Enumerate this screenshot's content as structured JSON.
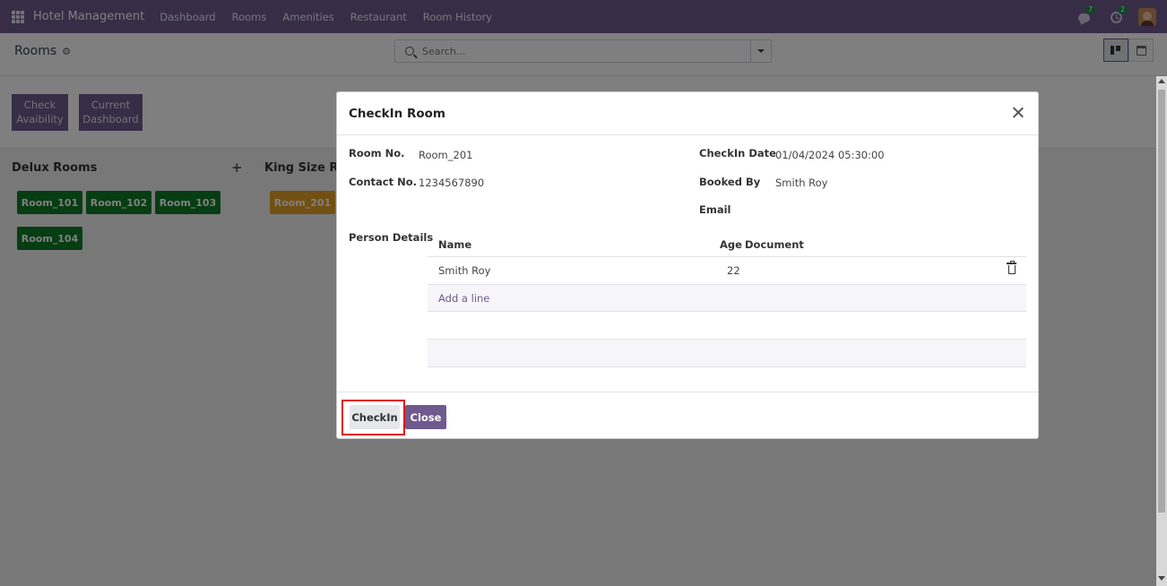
{
  "navbar": {
    "brand": "Hotel Management",
    "menu": [
      "Dashboard",
      "Rooms",
      "Amenities",
      "Restaurant",
      "Room History"
    ],
    "messages_count": "7",
    "activities_count": "2",
    "color": "#6f5a8e"
  },
  "control_panel": {
    "breadcrumb": "Rooms",
    "search_placeholder": "Search..."
  },
  "actions": {
    "check_availability": "Check Avaibility",
    "current_dashboard": "Current Dashboard"
  },
  "kanban": {
    "columns": [
      {
        "title": "Delux Rooms",
        "rooms": [
          "Room_101",
          "Room_102",
          "Room_103",
          "Room_104"
        ]
      },
      {
        "title": "King Size Roo",
        "rooms": [
          "Room_201"
        ]
      }
    ]
  },
  "modal": {
    "title": "CheckIn Room",
    "fields": {
      "room_no_label": "Room No.",
      "room_no_value": "Room_201",
      "contact_label": "Contact No.",
      "contact_value": "1234567890",
      "checkin_date_label": "CheckIn Date",
      "checkin_date_value": "01/04/2024 05:30:00",
      "booked_by_label": "Booked By",
      "booked_by_value": "Smith Roy",
      "email_label": "Email",
      "email_value": ""
    },
    "person_details": {
      "label": "Person Details",
      "columns": [
        "Name",
        "Age",
        "Document"
      ],
      "rows": [
        {
          "name": "Smith Roy",
          "age": "22",
          "document": ""
        }
      ],
      "add_line": "Add a line"
    },
    "buttons": {
      "checkin": "CheckIn",
      "close": "Close"
    }
  }
}
